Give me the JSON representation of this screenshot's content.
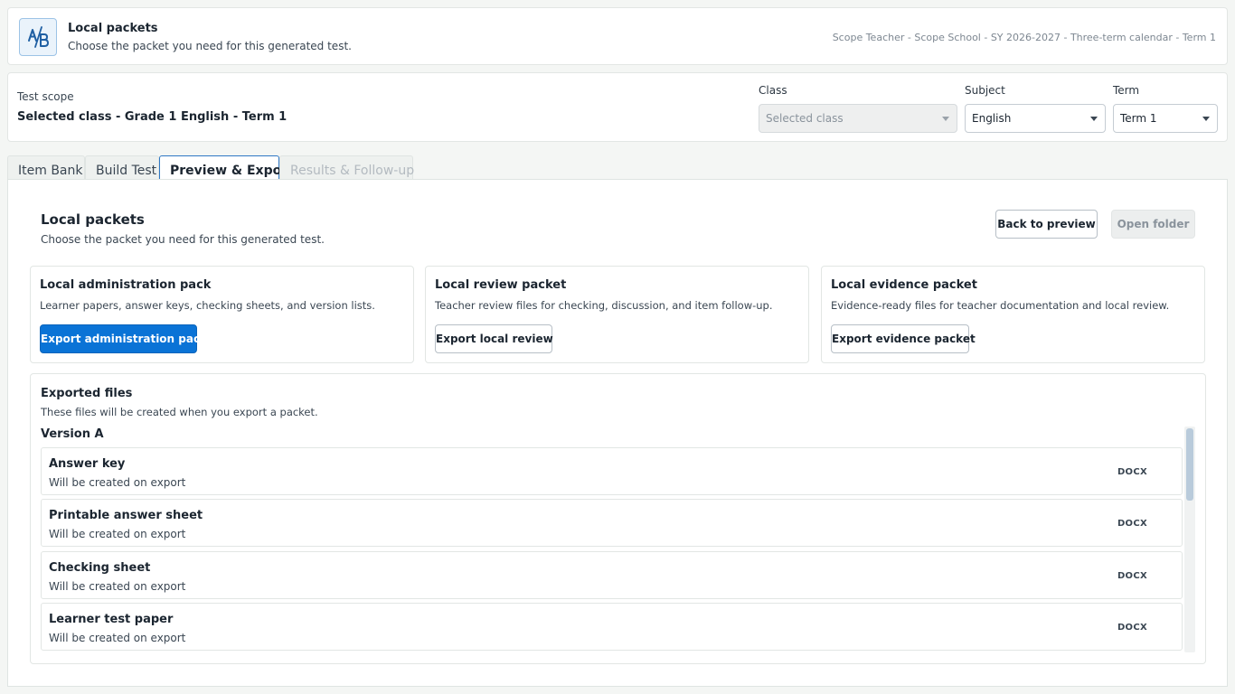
{
  "header": {
    "title": "Local packets",
    "subtitle": "Choose the packet you need for this generated test.",
    "context": "Scope Teacher - Scope School - SY 2026-2027 - Three-term calendar - Term 1",
    "logo_icon": "ab-version-icon"
  },
  "scope": {
    "label": "Test scope",
    "value": "Selected class - Grade 1 English - Term 1",
    "class_label": "Class",
    "class_value": "Selected class",
    "subject_label": "Subject",
    "subject_value": "English",
    "term_label": "Term",
    "term_value": "Term 1"
  },
  "tabs": [
    {
      "label": "Item Bank",
      "state": "normal"
    },
    {
      "label": "Build Test",
      "state": "normal"
    },
    {
      "label": "Preview & Export",
      "state": "active"
    },
    {
      "label": "Results & Follow-up",
      "state": "disabled"
    }
  ],
  "panel": {
    "title": "Local packets",
    "subtitle": "Choose the packet you need for this generated test.",
    "back_label": "Back to preview",
    "open_folder_label": "Open folder"
  },
  "packets": [
    {
      "title": "Local administration pack",
      "desc": "Learner papers, answer keys, checking sheets, and version lists.",
      "button": "Export administration pack"
    },
    {
      "title": "Local review packet",
      "desc": "Teacher review files for checking, discussion, and item follow-up.",
      "button": "Export local review"
    },
    {
      "title": "Local evidence packet",
      "desc": "Evidence-ready files for teacher documentation and local review.",
      "button": "Export evidence packet"
    }
  ],
  "files": {
    "title": "Exported files",
    "subtitle": "These files will be created when you export a packet.",
    "version": "Version A",
    "items": [
      {
        "name": "Answer key",
        "status": "Will be created on export",
        "format": "DOCX"
      },
      {
        "name": "Printable answer sheet",
        "status": "Will be created on export",
        "format": "DOCX"
      },
      {
        "name": "Checking sheet",
        "status": "Will be created on export",
        "format": "DOCX"
      },
      {
        "name": "Learner test paper",
        "status": "Will be created on export",
        "format": "DOCX"
      }
    ]
  },
  "colors": {
    "accent": "#0a73d6",
    "tab_border": "#2f78c4"
  }
}
